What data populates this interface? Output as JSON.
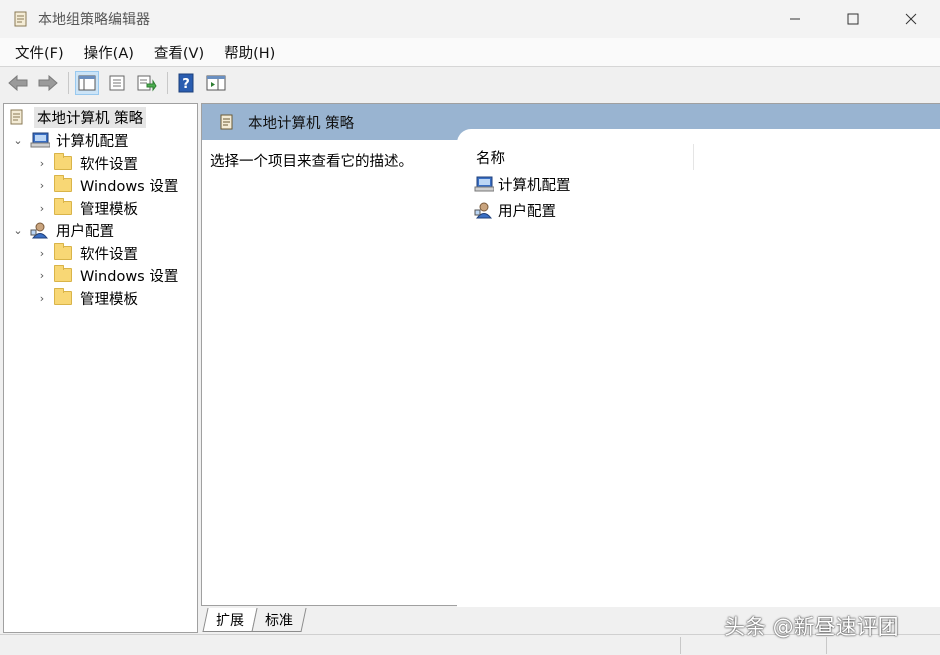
{
  "window": {
    "title": "本地组策略编辑器",
    "controls": {
      "minimize": "—",
      "maximize": "☐",
      "close": "✕"
    }
  },
  "menu": {
    "items": [
      "文件(F)",
      "操作(A)",
      "查看(V)",
      "帮助(H)"
    ]
  },
  "toolbar": {
    "buttons": [
      "back-arrow-icon",
      "forward-arrow-icon",
      "show-hide-tree-icon",
      "properties-icon",
      "export-list-icon",
      "help-icon",
      "show-action-pane-icon"
    ]
  },
  "tree": {
    "root": "本地计算机 策略",
    "computer": {
      "label": "计算机配置",
      "children": [
        "软件设置",
        "Windows 设置",
        "管理模板"
      ]
    },
    "user": {
      "label": "用户配置",
      "children": [
        "软件设置",
        "Windows 设置",
        "管理模板"
      ]
    }
  },
  "right": {
    "header": "本地计算机 策略",
    "description": "选择一个项目来查看它的描述。",
    "column_name": "名称",
    "items": [
      "计算机配置",
      "用户配置"
    ]
  },
  "tabs": [
    "扩展",
    "标准"
  ],
  "watermark": "头条 @新昼速评团",
  "colors": {
    "header_blue": "#99b4d1",
    "folder": "#f8d775",
    "selected": "#e5e5e5"
  }
}
